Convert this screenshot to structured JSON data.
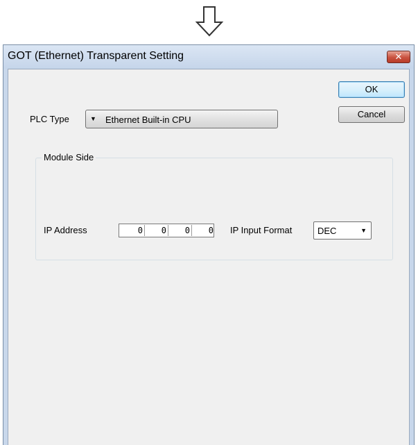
{
  "window": {
    "title": "GOT (Ethernet) Transparent Setting",
    "close_glyph": "✕"
  },
  "buttons": {
    "ok_label": "OK",
    "cancel_label": "Cancel"
  },
  "plc_type": {
    "label": "PLC Type",
    "value": "Ethernet Built-in CPU"
  },
  "module_side": {
    "group_label": "Module Side",
    "ip_address": {
      "label": "IP Address",
      "octets": [
        "0",
        "0",
        "0",
        "0"
      ]
    },
    "ip_input_format": {
      "label": "IP Input Format",
      "value": "DEC"
    }
  },
  "icons": {
    "top_arrow": "down-arrow-icon",
    "close": "close-icon",
    "dropdown": "dropdown-caret-icon"
  },
  "colors": {
    "title_bar": "#c8d7eb",
    "close_button": "#c9523f",
    "client_area": "#f0f0f0"
  }
}
